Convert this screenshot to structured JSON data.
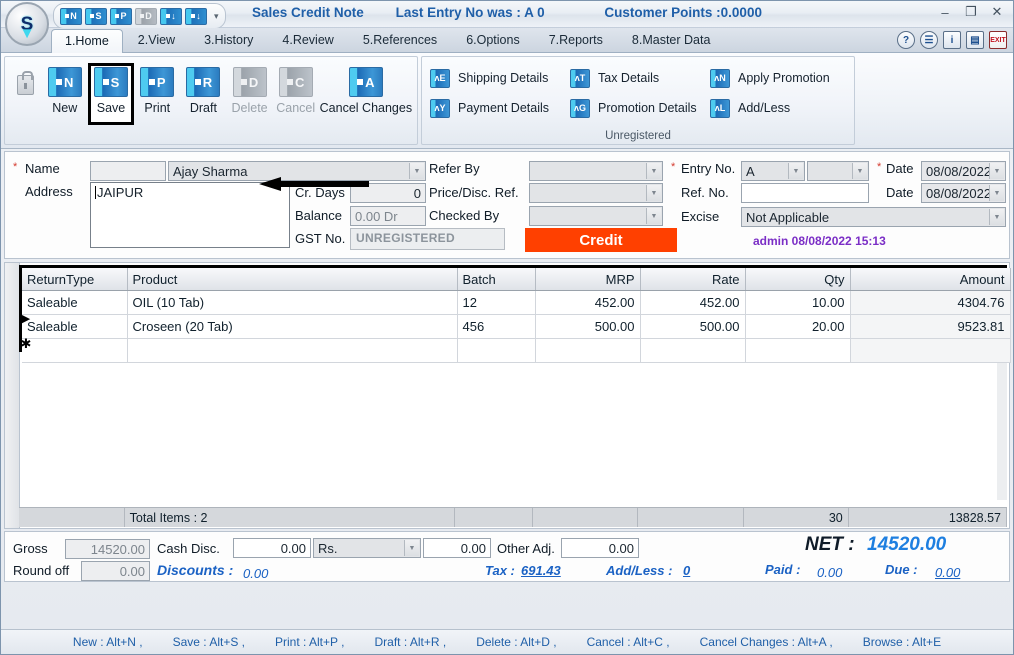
{
  "titlebar": {
    "logo_glyph": "S",
    "document_title": "Sales Credit Note",
    "last_entry": "Last Entry No was : A 0",
    "customer_points": "Customer Points :0.0000",
    "quick_access": [
      {
        "name": "new",
        "letter": "N",
        "disabled": false
      },
      {
        "name": "save",
        "letter": "S",
        "disabled": false
      },
      {
        "name": "print",
        "letter": "P",
        "disabled": false
      },
      {
        "name": "draft",
        "letter": "D",
        "disabled": true
      },
      {
        "name": "prev",
        "letter": "↓",
        "disabled": false
      },
      {
        "name": "next",
        "letter": "↓",
        "disabled": false
      }
    ],
    "qat_overflow": "▾",
    "window_buttons": [
      "–",
      "❐",
      "✕"
    ]
  },
  "tabs": [
    {
      "label": "1.Home",
      "active": true
    },
    {
      "label": "2.View",
      "active": false
    },
    {
      "label": "3.History",
      "active": false
    },
    {
      "label": "4.Review",
      "active": false
    },
    {
      "label": "5.References",
      "active": false
    },
    {
      "label": "6.Options",
      "active": false
    },
    {
      "label": "7.Reports",
      "active": false
    },
    {
      "label": "8.Master Data",
      "active": false
    }
  ],
  "tab_icons": [
    {
      "name": "help-icon",
      "glyph": "?"
    },
    {
      "name": "support-icon",
      "glyph": "☰"
    },
    {
      "name": "info-icon",
      "glyph": "i"
    },
    {
      "name": "notes-icon",
      "glyph": "▤"
    },
    {
      "name": "exit-icon",
      "glyph": "EXIT"
    }
  ],
  "ribbon": {
    "group1": {
      "lock_icon": "lock-icon",
      "buttons": [
        {
          "label": "New",
          "letter": "N",
          "disabled": false,
          "selected": false
        },
        {
          "label": "Save",
          "letter": "S",
          "disabled": false,
          "selected": true
        },
        {
          "label": "Print",
          "letter": "P",
          "disabled": false,
          "selected": false
        },
        {
          "label": "Draft",
          "letter": "R",
          "disabled": false,
          "selected": false
        },
        {
          "label": "Delete",
          "letter": "D",
          "disabled": true,
          "selected": false
        },
        {
          "label": "Cancel",
          "letter": "C",
          "disabled": true,
          "selected": false
        },
        {
          "label": "Cancel Changes",
          "letter": "A",
          "disabled": false,
          "selected": false
        }
      ]
    },
    "group2": {
      "title": "Unregistered",
      "buttons": [
        {
          "label": "Shipping Details",
          "letter": "ʊE"
        },
        {
          "label": "Tax Details",
          "letter": "ʊT"
        },
        {
          "label": "Apply Promotion",
          "letter": "ʊN"
        },
        {
          "label": "Payment Details",
          "letter": "ʊY"
        },
        {
          "label": "Promotion Details",
          "letter": "ʊG"
        },
        {
          "label": "Add/Less",
          "letter": "ʊL"
        }
      ]
    }
  },
  "form": {
    "name_label": "Name",
    "name_code_value": "",
    "name_value": "Ajay Sharma",
    "address_label": "Address",
    "address_value": "JAIPUR",
    "cr_days_label": "Cr. Days",
    "cr_days_value": "0",
    "balance_label": "Balance",
    "balance_value": "0.00 Dr",
    "gst_label": "GST No.",
    "gst_value": "UNREGISTERED",
    "refer_by_label": "Refer By",
    "refer_by_value": "",
    "price_disc_label": "Price/Disc. Ref.",
    "price_disc_value": "",
    "checked_by_label": "Checked By",
    "checked_by_value": "",
    "entry_no_label": "Entry No.",
    "entry_no_series": "A",
    "entry_no_value": "",
    "ref_no_label": "Ref. No.",
    "ref_no_value": "",
    "excise_label": "Excise",
    "excise_value": "Not Applicable",
    "date1_label": "Date",
    "date1_value": "08/08/2022",
    "date2_label": "Date",
    "date2_value": "08/08/2022",
    "credit_button": "Credit",
    "user_stamp": "admin 08/08/2022 15:13"
  },
  "grid": {
    "columns": [
      "ReturnType",
      "Product",
      "Batch",
      "MRP",
      "Rate",
      "Qty",
      "Amount"
    ],
    "rows": [
      {
        "ReturnType": "Saleable",
        "Product": "OIL (10 Tab)",
        "Batch": "12",
        "MRP": "452.00",
        "Rate": "452.00",
        "Qty": "10.00",
        "Amount": "4304.76"
      },
      {
        "ReturnType": "Saleable",
        "Product": "Croseen (20 Tab)",
        "Batch": "456",
        "MRP": "500.00",
        "Rate": "500.00",
        "Qty": "20.00",
        "Amount": "9523.81"
      },
      {
        "ReturnType": "",
        "Product": "",
        "Batch": "",
        "MRP": "",
        "Rate": "",
        "Qty": "",
        "Amount": ""
      }
    ],
    "selected_row_marker": "▶",
    "new_row_marker": "✱",
    "footer": {
      "total_items": "Total Items : 2",
      "qty_total": "30",
      "amount_total": "13828.57"
    }
  },
  "summary": {
    "gross_label": "Gross",
    "gross_value": "14520.00",
    "cash_disc_label": "Cash Disc.",
    "cash_disc_pct": "0.00",
    "cash_disc_unit": "Rs.",
    "cash_disc_amount": "0.00",
    "other_adj_label": "Other Adj.",
    "other_adj_value": "0.00",
    "round_off_label": "Round off",
    "round_off_value": "0.00",
    "discounts_label": "Discounts :",
    "discounts_value": "0.00",
    "tax_label": "Tax :",
    "tax_value": "691.43",
    "add_less_label": "Add/Less :",
    "add_less_value": "0",
    "net_label": "NET :",
    "net_value": "14520.00",
    "paid_label": "Paid :",
    "paid_value": "0.00",
    "due_label": "Due :",
    "due_value": "0.00"
  },
  "status_bar": [
    "New : Alt+N ,",
    "Save : Alt+S ,",
    "Print : Alt+P ,",
    "Draft : Alt+R ,",
    "Delete : Alt+D ,",
    "Cancel : Alt+C ,",
    "Cancel Changes : Alt+A ,",
    "Browse : Alt+E"
  ],
  "colors": {
    "accent_blue": "#1f5fa8",
    "credit_orange": "#ff4000",
    "net_blue": "#1e7fe0",
    "stamp_purple": "#7b2ec6"
  }
}
